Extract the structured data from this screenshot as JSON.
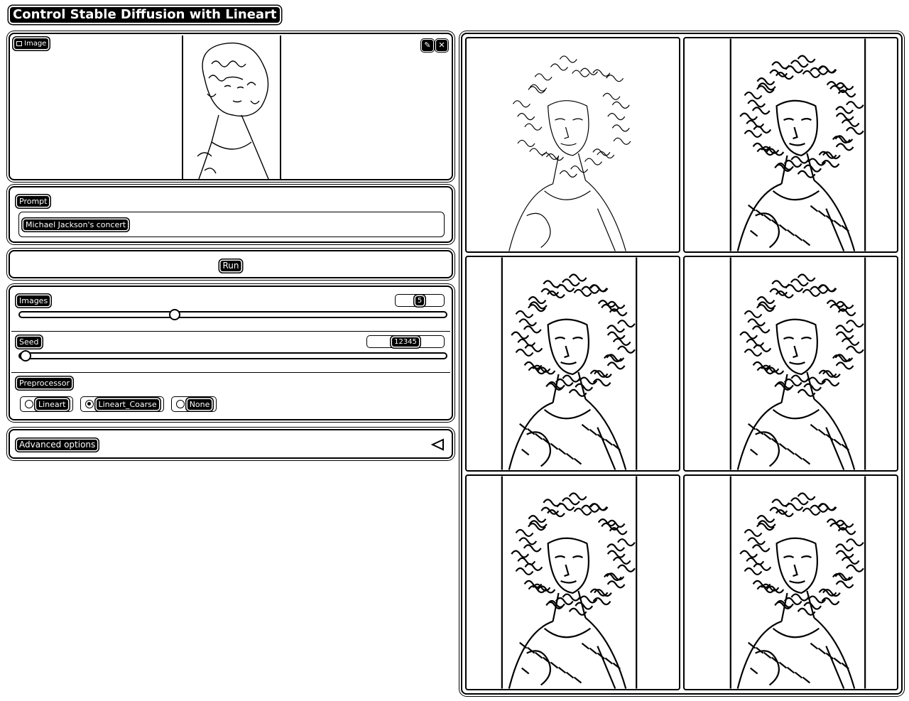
{
  "app": {
    "title": "Control Stable Diffusion with Lineart"
  },
  "image_input": {
    "label": "Image",
    "icon": "image-icon",
    "edit_icon": "pencil-icon",
    "clear_icon": "close-icon"
  },
  "prompt": {
    "label": "Prompt",
    "value": "Michael Jackson's concert"
  },
  "run_button": {
    "label": "Run"
  },
  "images_slider": {
    "label": "Images",
    "value": "5",
    "fraction": 0.36
  },
  "seed_slider": {
    "label": "Seed",
    "value": "12345",
    "fraction": 0.0
  },
  "preprocessor": {
    "label": "Preprocessor",
    "options": [
      "Lineart",
      "Lineart_Coarse",
      "None"
    ],
    "selected": "Lineart_Coarse"
  },
  "advanced": {
    "label": "Advanced options",
    "icon": "collapse-triangle-icon"
  },
  "gallery": {
    "items": [
      "lineart-result-1",
      "lineart-result-2",
      "lineart-result-3",
      "lineart-result-4",
      "lineart-result-5",
      "lineart-result-6"
    ]
  }
}
